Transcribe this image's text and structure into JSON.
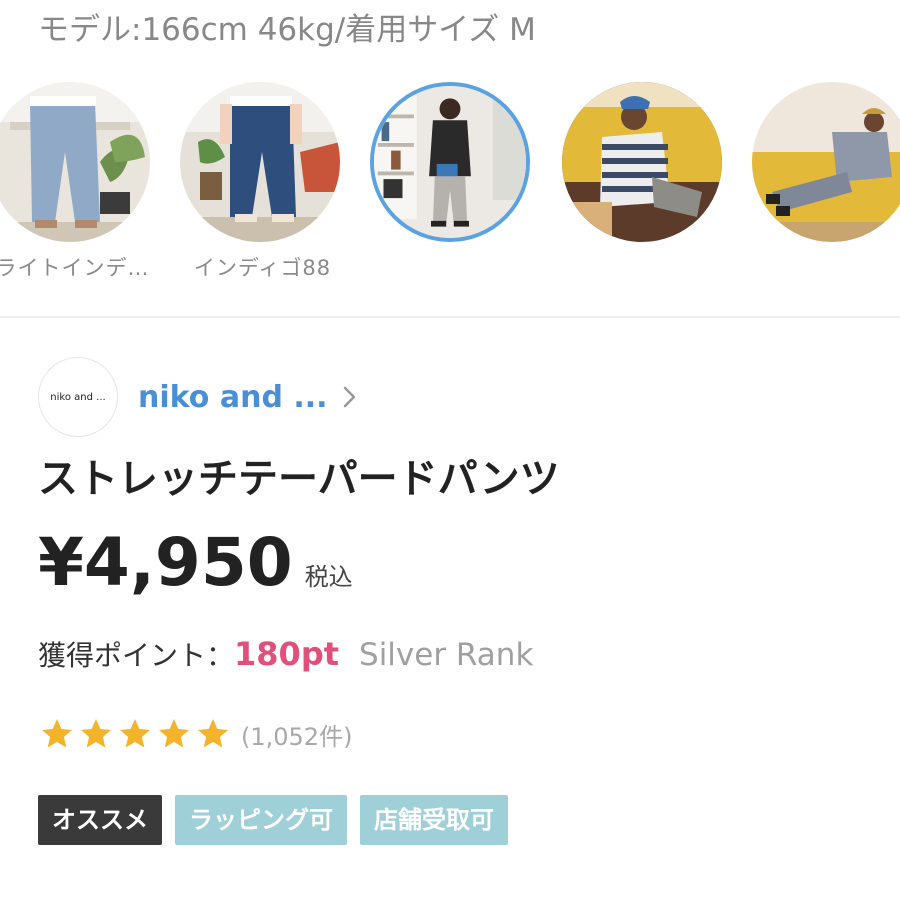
{
  "header": {
    "model_info": "モデル:166cm 46kg/着用サイズ M"
  },
  "swatches": [
    {
      "label": "ライトインデ…",
      "selected": false,
      "icon": "light-indigo-jeans-photo"
    },
    {
      "label": "インディゴ88",
      "selected": false,
      "icon": "indigo-jeans-photo"
    },
    {
      "label": "",
      "selected": true,
      "icon": "black-outfit-photo"
    },
    {
      "label": "",
      "selected": false,
      "icon": "striped-sweater-photo"
    },
    {
      "label": "",
      "selected": false,
      "icon": "gray-outfit-photo"
    }
  ],
  "brand": {
    "logo_text": "niko and ...",
    "name": "niko and ...",
    "chevron_icon": "chevron-right-icon"
  },
  "product": {
    "title": "ストレッチテーパードパンツ",
    "price": "¥4,950",
    "tax_label": "税込"
  },
  "points": {
    "label": "獲得ポイント：",
    "value": "180pt",
    "rank": "Silver Rank"
  },
  "rating": {
    "stars": 5,
    "max_stars": 5,
    "count_text": "(1,052件)"
  },
  "tags": [
    {
      "label": "オススメ",
      "color": "#3a3a3a"
    },
    {
      "label": "ラッピング可",
      "color": "#9fd0d8"
    },
    {
      "label": "店舗受取可",
      "color": "#9fd0d8"
    }
  ],
  "colors": {
    "brand_link": "#4a8fd6",
    "points": "#e0507a",
    "star": "#f3b42c",
    "selected_border": "#5aa3e0"
  }
}
